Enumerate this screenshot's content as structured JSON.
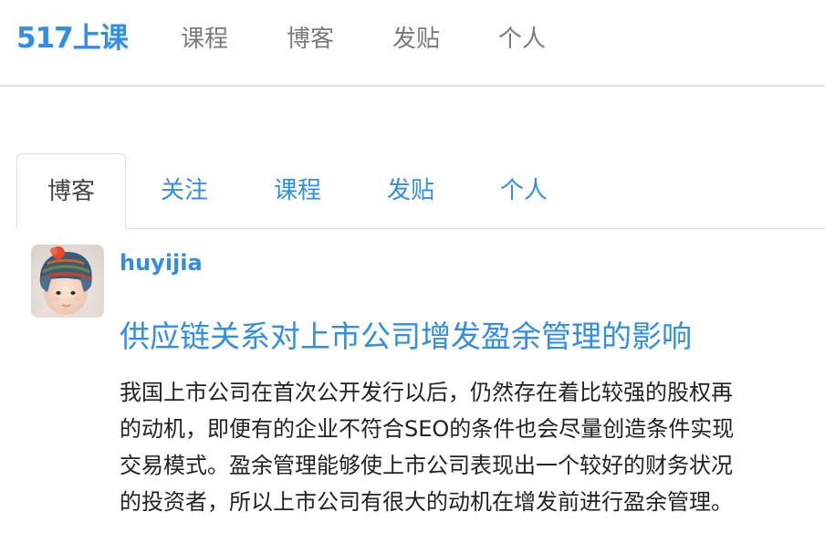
{
  "header": {
    "logo": "517上课",
    "nav": [
      "课程",
      "博客",
      "发贴",
      "个人"
    ]
  },
  "tabs": [
    "博客",
    "关注",
    "课程",
    "发贴",
    "个人"
  ],
  "post": {
    "author": "huyijia",
    "title": "供应链关系对上市公司增发盈余管理的影响",
    "excerpt_lines": [
      "我国上市公司在首次公开发行以后，仍然存在着比较强的股权再",
      "的动机，即便有的企业不符合SEO的条件也会尽量创造条件实现",
      "交易模式。盈余管理能够使上市公司表现出一个较好的财务状况",
      "的投资者，所以上市公司有很大的动机在增发前进行盈余管理。"
    ]
  },
  "colors": {
    "accent": "#2f8ee8",
    "nav_text": "#7a7a7a",
    "body_text": "#222222",
    "divider": "#dddddd"
  }
}
